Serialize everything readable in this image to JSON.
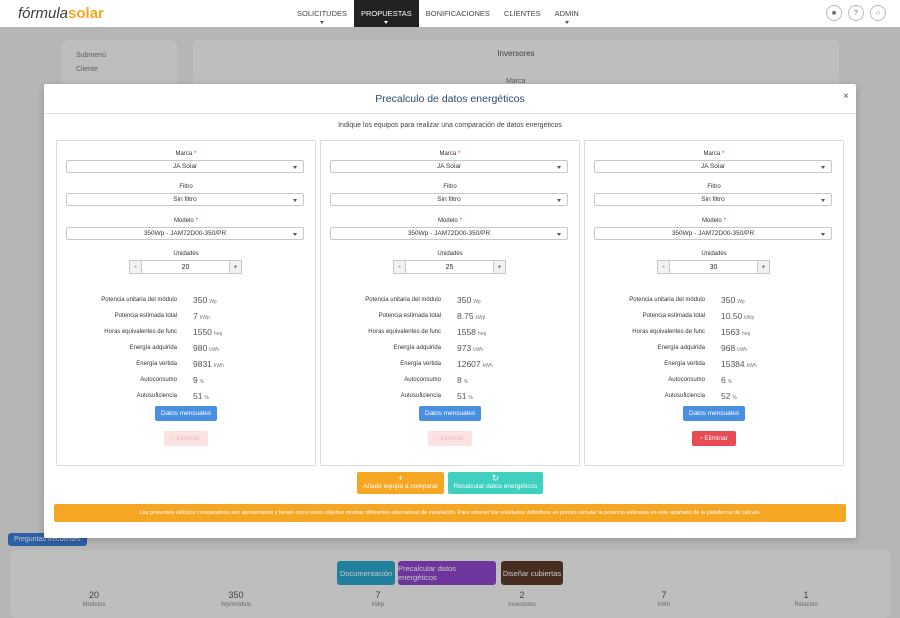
{
  "topbar": {
    "logo_main": "fórmula",
    "logo_accent": "solar",
    "nav": [
      "SOLICITUDES",
      "PROPUESTAS",
      "BONIFICACIONES",
      "CLIENTES",
      "ADMIN"
    ],
    "active_nav": "PROPUESTAS"
  },
  "background": {
    "sidebar_heading": "Submenú",
    "sidebar_item": "Cliente",
    "section_title": "Inversores",
    "marca_label": "Marca",
    "faq_button": "Preguntas frecuentes",
    "buttons": {
      "documentacion": "Documentación",
      "precalcular": "Precalcular datos energéticos",
      "disenar": "Diseñar cubiertas"
    },
    "stats": [
      {
        "value": "20",
        "label": "Módulos"
      },
      {
        "value": "350",
        "label": "Wp/módulo"
      },
      {
        "value": "7",
        "label": "kWp"
      },
      {
        "value": "2",
        "label": "Inversores"
      },
      {
        "value": "7",
        "label": "kWn"
      },
      {
        "value": "1",
        "label": "Relación"
      }
    ]
  },
  "modal": {
    "title": "Precalculo de datos energéticos",
    "close": "×",
    "subtitle": "Indique los equipos para realizar una comparación de datos energéticos",
    "labels": {
      "marca": "Marca",
      "filtro": "Filtro",
      "modelo": "Modelo",
      "unidades": "Unidades",
      "required": "*"
    },
    "metric_labels": {
      "potencia_unitaria": "Potencia unitaria del módulo",
      "potencia_total": "Potencia estimada total",
      "horas": "Horas equivalentes de func",
      "energia_adquirida": "Energía adquirida",
      "energia_vertida": "Energía vertida",
      "autoconsumo": "Autoconsumo",
      "autosuficiencia": "Autosuficiencia"
    },
    "metric_units": {
      "potencia_unitaria": "Wp",
      "potencia_total": "kWp",
      "horas": "heq",
      "energia_adquirida": "kWh",
      "energia_vertida": "kWh",
      "autoconsumo": "%",
      "autosuficiencia": "%"
    },
    "stepper": {
      "minus": "-",
      "plus": "+"
    },
    "columns": [
      {
        "marca": "JA Solar",
        "filtro": "Sin filtro",
        "modelo": "350Wp - JAM72D00-350/PR",
        "unidades": "20",
        "potencia_unitaria": "350",
        "potencia_total": "7",
        "horas": "1550",
        "energia_adquirida": "980",
        "energia_vertida": "9831",
        "autoconsumo": "9",
        "autosuficiencia": "51",
        "monthly_label": "Datos mensuales",
        "delete_label": "Eliminar",
        "delete_enabled": false
      },
      {
        "marca": "JA Solar",
        "filtro": "Sin filtro",
        "modelo": "350Wp - JAM72D00-350/PR",
        "unidades": "25",
        "potencia_unitaria": "350",
        "potencia_total": "8.75",
        "horas": "1558",
        "energia_adquirida": "973",
        "energia_vertida": "12607",
        "autoconsumo": "8",
        "autosuficiencia": "51",
        "monthly_label": "Datos mensuales",
        "delete_label": "Eliminar",
        "delete_enabled": false
      },
      {
        "marca": "JA Solar",
        "filtro": "Sin filtro",
        "modelo": "350Wp - JAM72D00-350/PR",
        "unidades": "30",
        "potencia_unitaria": "350",
        "potencia_total": "10.50",
        "horas": "1563",
        "energia_adquirida": "968",
        "energia_vertida": "15384",
        "autoconsumo": "6",
        "autosuficiencia": "52",
        "monthly_label": "Datos mensuales",
        "delete_label": "Eliminar",
        "delete_enabled": true
      }
    ],
    "add_button": "Añadir equipo a comparar",
    "recalc_button": "Recalcular datos energéticos",
    "warning": "Los presentes cálculos comparativos son aproximados y tienen como único objetivo mostrar diferentes alternativas de instalación. Para obtener los resultados definitivos es preciso simular la potencia estimada en este apartado de la plataforma de cálculo."
  },
  "colors": {
    "accent_orange": "#f5a623",
    "accent_teal": "#3fd0bf",
    "primary_blue": "#4a90e2",
    "danger_red": "#e94b55"
  }
}
